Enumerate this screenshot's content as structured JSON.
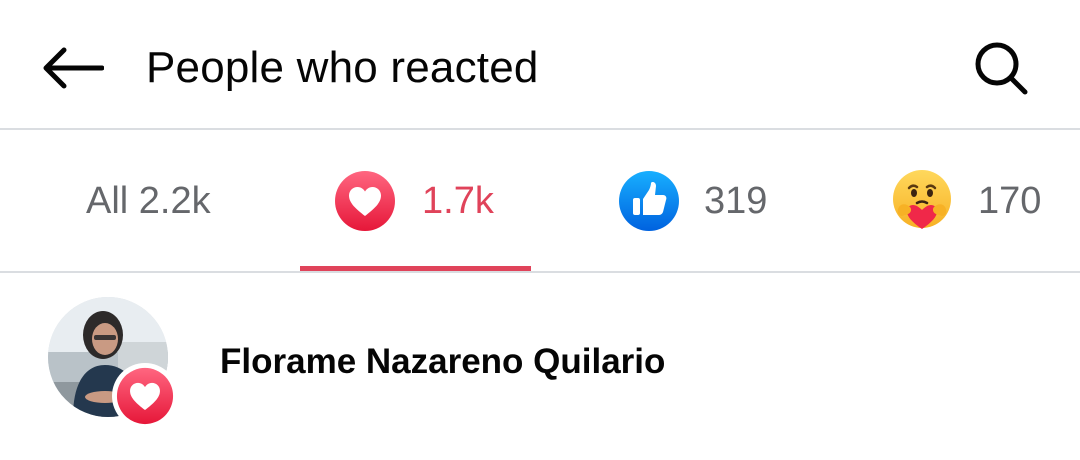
{
  "header": {
    "title": "People who reacted",
    "back_icon": "arrow-left-icon",
    "search_icon": "search-icon"
  },
  "tabs": [
    {
      "id": "all",
      "label": "All 2.2k",
      "count": "All 2.2k",
      "selected": false
    },
    {
      "id": "love",
      "icon": "love-reaction-icon",
      "count": "1.7k",
      "selected": true
    },
    {
      "id": "like",
      "icon": "like-reaction-icon",
      "count": "319",
      "selected": false
    },
    {
      "id": "care",
      "icon": "care-reaction-icon",
      "count": "170",
      "selected": false
    }
  ],
  "reactors": [
    {
      "name": "Florame Nazareno Quilario",
      "reaction": "love-reaction-icon"
    }
  ],
  "colors": {
    "accent": "#e0435a",
    "like_blue": "#1b74e4",
    "text_primary": "#050505",
    "text_secondary": "#65676b",
    "divider": "#dadde1"
  }
}
